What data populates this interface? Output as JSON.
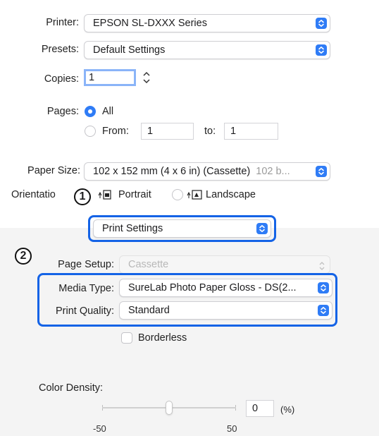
{
  "printer": {
    "label": "Printer:",
    "value": "EPSON SL-DXXX Series"
  },
  "presets": {
    "label": "Presets:",
    "value": "Default Settings"
  },
  "copies": {
    "label": "Copies:",
    "value": "1"
  },
  "pages": {
    "label": "Pages:",
    "all_label": "All",
    "from_label": "From:",
    "from_value": "1",
    "to_label": "to:",
    "to_value": "1",
    "selected": "All"
  },
  "paper_size": {
    "label": "Paper Size:",
    "value": "102 x 152 mm (4 x 6 in) (Cassette)",
    "value_suffix": "102 b..."
  },
  "orientation": {
    "label": "Orientatio",
    "portrait_label": "Portrait",
    "landscape_label": "Landscape",
    "selected": "Portrait"
  },
  "section_popup": {
    "value": "Print Settings"
  },
  "page_setup": {
    "label": "Page Setup:",
    "value": "Cassette"
  },
  "media_type": {
    "label": "Media Type:",
    "value": "SureLab Photo Paper Gloss - DS(2..."
  },
  "print_quality": {
    "label": "Print Quality:",
    "value": "Standard"
  },
  "borderless": {
    "label": "Borderless",
    "checked": false
  },
  "color_density": {
    "label": "Color Density:",
    "value": "0",
    "unit": "(%)",
    "min_label": "-50",
    "max_label": "50"
  },
  "callouts": {
    "one": "1",
    "two": "2"
  },
  "colors": {
    "accent": "#2f7cf6",
    "highlight": "#1463e6"
  }
}
